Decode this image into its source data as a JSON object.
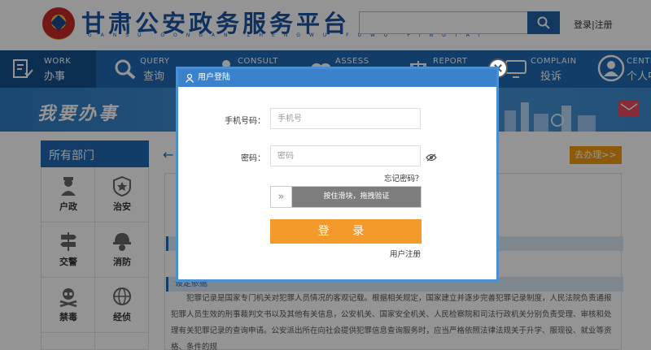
{
  "header": {
    "title": "甘肃公安政务服务平台",
    "subtitle": "GANSU GONGAN ZHENGWU FUWU PINGTAI",
    "search": {
      "value": "",
      "placeholder": ""
    },
    "login_link": "登录",
    "separator": "|",
    "register_link": "注册"
  },
  "nav": [
    {
      "en": "WORK",
      "cn": "办事",
      "icon": "document-check-icon"
    },
    {
      "en": "QUERY",
      "cn": "查询",
      "icon": "magnifier-icon"
    },
    {
      "en": "CONSULT",
      "cn": "",
      "icon": "person-icon"
    },
    {
      "en": "ASSESS",
      "cn": "",
      "icon": "hearts-icon"
    },
    {
      "en": "REPORT",
      "cn": "",
      "icon": "scale-icon"
    },
    {
      "en": "COMPLAIN",
      "cn": "投诉",
      "icon": "monitor-icon"
    },
    {
      "en": "CENTER",
      "cn": "个人中心",
      "icon": "user-circle-icon"
    }
  ],
  "banner": {
    "text": "我要办事"
  },
  "sidebar": {
    "title": "所有部门",
    "depts": [
      {
        "label": "户政",
        "icon": "officer-icon"
      },
      {
        "label": "治安",
        "icon": "badge-icon"
      },
      {
        "label": "交警",
        "icon": "road-sign-icon"
      },
      {
        "label": "消防",
        "icon": "firefighter-icon"
      },
      {
        "label": "禁毒",
        "icon": "skull-icon"
      },
      {
        "label": "经侦",
        "icon": "globe-icon"
      }
    ]
  },
  "main": {
    "back": "←",
    "go_button": "去办理>>",
    "strip1": "",
    "strip2": "设定依据",
    "body": "犯罪记录是国家专门机关对犯罪人员情况的客观记载。根据相关规定，国家建立并逐步完善犯罪记录制度，人民法院负责通报犯罪人员生效的刑事裁判文书以及其他有关信息，公安机关、国家安全机关、人民检察院和司法行政机关分别负责受理、审核和处理有关犯罪记录的查询申请。公安派出所在向社会提供犯罪信息查询服务时，应当严格依照法律法规关于升学、服现役、就业等资格、条件的规"
  },
  "modal": {
    "title": "用户登陆",
    "phone_label": "手机号码：",
    "phone_placeholder": "手机号",
    "password_label": "密码：",
    "password_placeholder": "密码",
    "forgot": "忘记密码？",
    "slider_handle": "»",
    "slider_text": "按住滑块，拖拽验证",
    "login_button": "登 录",
    "register": "用户注册"
  },
  "colors": {
    "brand_blue": "#1e6ab4",
    "login_orange": "#f39a2b",
    "title_blue": "#1a55a6"
  }
}
